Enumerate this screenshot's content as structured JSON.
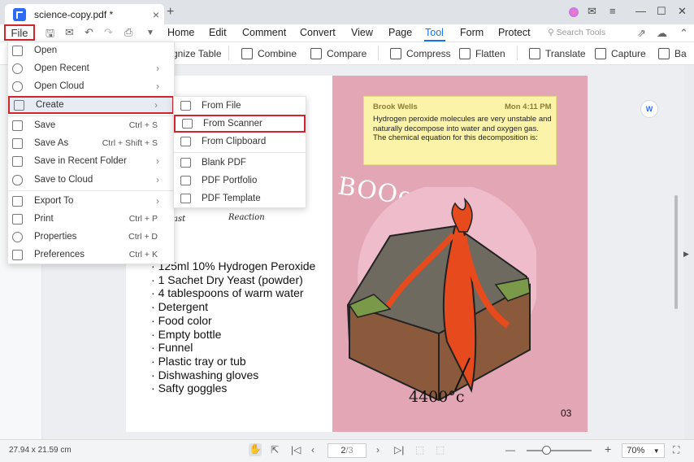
{
  "tab": {
    "title": "science-copy.pdf *",
    "close_icon": "×",
    "new_tab_icon": "+"
  },
  "window": {
    "minimize": "—",
    "maximize": "☐",
    "close": "✕",
    "menu": "≡"
  },
  "menubar": {
    "file": "File",
    "items": [
      "Home",
      "Edit",
      "Comment",
      "Convert",
      "View",
      "Page",
      "Tool",
      "Form",
      "Protect"
    ],
    "active": "Tool",
    "search_placeholder": "Search Tools"
  },
  "toolbar": {
    "items": [
      "gnize Table",
      "Combine",
      "Compare",
      "Compress",
      "Flatten",
      "Translate",
      "Capture",
      "Ba"
    ]
  },
  "file_menu": {
    "items": [
      {
        "label": "Open",
        "shortcut": "",
        "arrow": ""
      },
      {
        "label": "Open Recent",
        "shortcut": "",
        "arrow": "›"
      },
      {
        "label": "Open Cloud",
        "shortcut": "",
        "arrow": "›"
      },
      {
        "label": "Create",
        "shortcut": "",
        "arrow": "›"
      },
      {
        "label": "Save",
        "shortcut": "Ctrl + S",
        "arrow": ""
      },
      {
        "label": "Save As",
        "shortcut": "Ctrl + Shift + S",
        "arrow": ""
      },
      {
        "label": "Save in Recent Folder",
        "shortcut": "",
        "arrow": "›"
      },
      {
        "label": "Save to Cloud",
        "shortcut": "",
        "arrow": "›"
      },
      {
        "label": "Export To",
        "shortcut": "",
        "arrow": "›"
      },
      {
        "label": "Print",
        "shortcut": "Ctrl + P",
        "arrow": ""
      },
      {
        "label": "Properties",
        "shortcut": "Ctrl + D",
        "arrow": ""
      },
      {
        "label": "Preferences",
        "shortcut": "Ctrl + K",
        "arrow": ""
      }
    ]
  },
  "create_submenu": {
    "items": [
      "From File",
      "From Scanner",
      "From Clipboard",
      "Blank PDF",
      "PDF Portfolio",
      "PDF Template"
    ]
  },
  "document": {
    "note_author": "Brook Wells",
    "note_time": "Mon 4:11 PM",
    "note_text": "Hydrogen peroxide molecules are very unstable and naturally decompose into water and oxygen gas. The chemical equation for this decomposition is:",
    "booo": "BOOoooh",
    "bang": "!",
    "temperature": "4400°c",
    "page_number": "03",
    "hand_label_1": "ast",
    "hand_label_2": "Reaction",
    "materials": [
      "125ml 10% Hydrogen Peroxide",
      "1 Sachet Dry Yeast (powder)",
      "4 tablespoons of warm water",
      "Detergent",
      "Food color",
      "Empty bottle",
      "Funnel",
      "Plastic tray or tub",
      "Dishwashing gloves",
      "Safty goggles"
    ]
  },
  "statusbar": {
    "dimensions": "27.94 x 21.59 cm",
    "current_page": "2",
    "total_pages": "/3",
    "zoom": "70%",
    "zoom_fraction": 0.3
  },
  "colors": {
    "accent": "#1a73e8",
    "highlight": "#d0262c",
    "page_pink": "#e3a6b4",
    "note": "#fbf3a8"
  }
}
